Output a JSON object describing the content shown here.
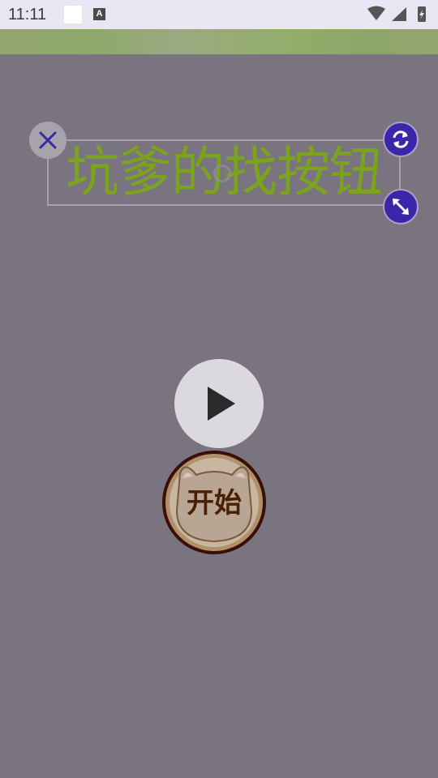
{
  "status_bar": {
    "time": "11:11",
    "notification_letter": "A",
    "icons": [
      "wifi-icon",
      "cell-signal-icon",
      "battery-icon"
    ]
  },
  "sticker": {
    "text": "坑爹的找按钮",
    "text_color": "#7ba31c"
  },
  "controls": {
    "close_icon": "close-icon",
    "rotate_icon": "rotate-icon",
    "scale_icon": "resize-icon",
    "accent": "#3b25a8"
  },
  "player": {
    "play_icon": "play-icon"
  },
  "start_button": {
    "label": "开始"
  }
}
